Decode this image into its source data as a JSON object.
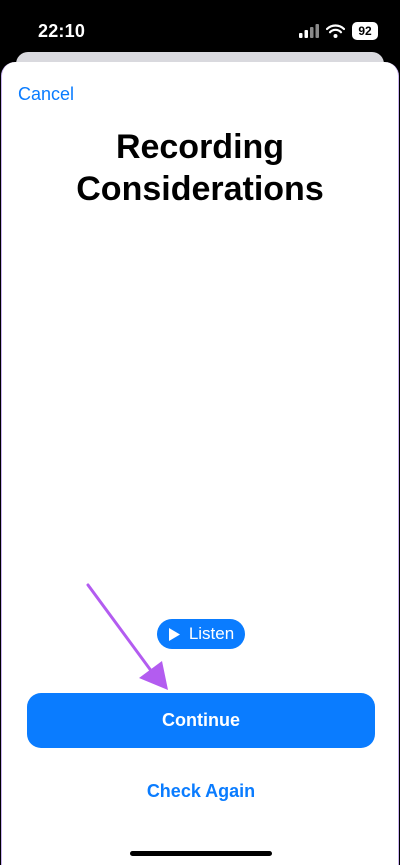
{
  "status_bar": {
    "time": "22:10",
    "battery": "92",
    "icons": [
      "cellular-signal-icon",
      "wifi-icon",
      "battery-icon"
    ]
  },
  "sheet": {
    "cancel_label": "Cancel",
    "title": "Recording Considerations",
    "listen_label": "Listen",
    "continue_label": "Continue",
    "check_again_label": "Check Again"
  },
  "colors": {
    "accent": "#0a7cff",
    "annotation_arrow": "#b35cf0"
  }
}
